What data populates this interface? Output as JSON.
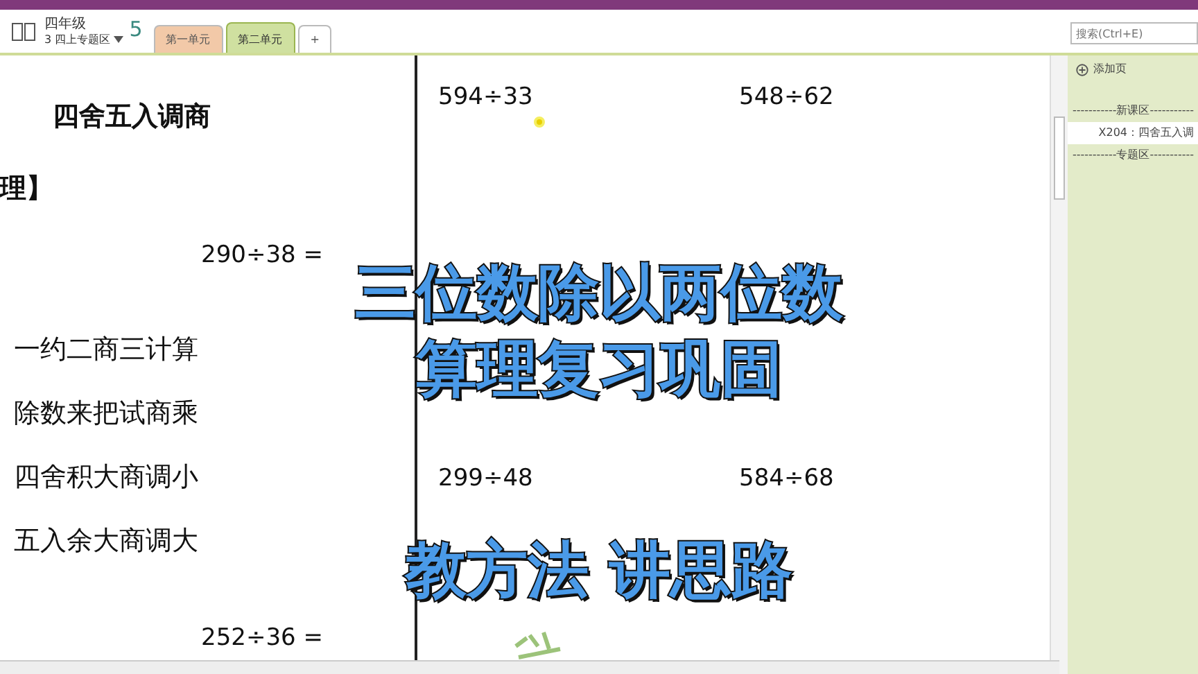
{
  "notebook": {
    "name": "四年级",
    "section_group": "3 四上专题区",
    "back_label": "5"
  },
  "section_tabs": [
    {
      "label": "第一单元",
      "color": "#f2c9a8",
      "selected": false
    },
    {
      "label": "第二单元",
      "color": "#cfe0a0",
      "selected": true
    },
    {
      "label": "+",
      "color": "#ffffff",
      "selected": false
    }
  ],
  "search": {
    "placeholder": "搜索(Ctrl+E)"
  },
  "page": {
    "notes": [
      {
        "text": "四舍五入调商",
        "kind": "heading"
      },
      {
        "text": "理】",
        "kind": "heading"
      },
      {
        "text": "290÷38 =",
        "kind": "formula"
      },
      {
        "text": "一约二商三计算",
        "kind": "line"
      },
      {
        "text": "除数来把试商乘",
        "kind": "line"
      },
      {
        "text": "四舍积大商调小",
        "kind": "line"
      },
      {
        "text": "五入余大商调大",
        "kind": "line"
      },
      {
        "text": "252÷36 =",
        "kind": "formula"
      },
      {
        "text": "594÷33",
        "kind": "formula"
      },
      {
        "text": "548÷62",
        "kind": "formula"
      },
      {
        "text": "299÷48",
        "kind": "formula"
      },
      {
        "text": "584÷68",
        "kind": "formula"
      }
    ]
  },
  "overlay_title": [
    "三位数除以两位数",
    "算理复习巩固",
    "教方法 讲思路"
  ],
  "page_list": {
    "add_label": "添加页",
    "items": [
      {
        "label": "-----------新课区-----------",
        "kind": "separator",
        "selected": false
      },
      {
        "label": "X204：四舍五入调",
        "kind": "page",
        "selected": true
      },
      {
        "label": "-----------专题区-----------",
        "kind": "separator",
        "selected": false
      }
    ]
  }
}
